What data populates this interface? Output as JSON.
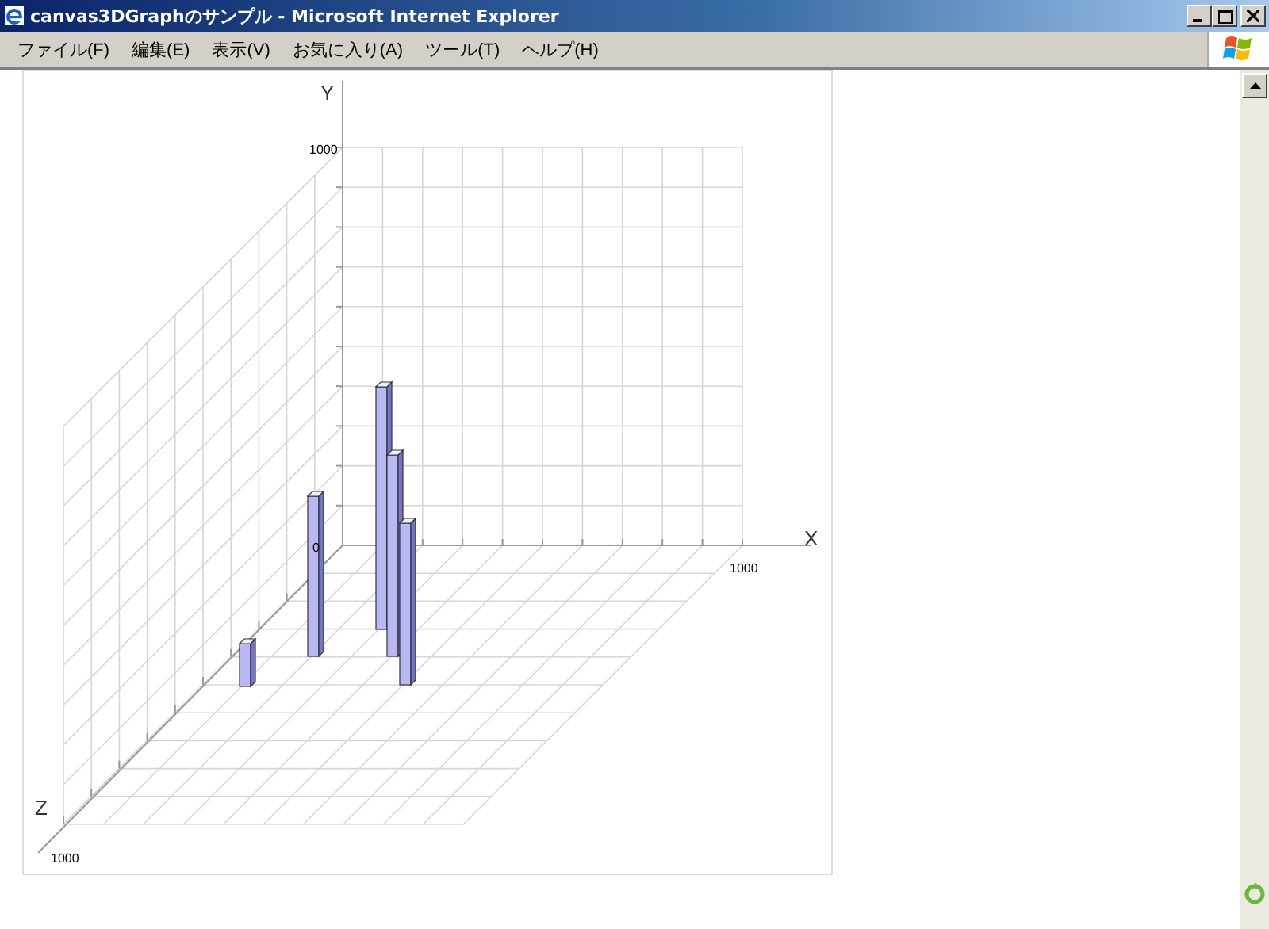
{
  "window": {
    "title": "canvas3DGraphのサンプル - Microsoft Internet Explorer"
  },
  "menu": [
    "ファイル(F)",
    "編集(E)",
    "表示(V)",
    "お気に入り(A)",
    "ツール(T)",
    "ヘルプ(H)"
  ],
  "graph": {
    "y_title": "Y",
    "x_title": "X",
    "z_title": "Z",
    "y_max": "1000",
    "x_max": "1000",
    "z_max": "1000",
    "origin": "0"
  }
}
